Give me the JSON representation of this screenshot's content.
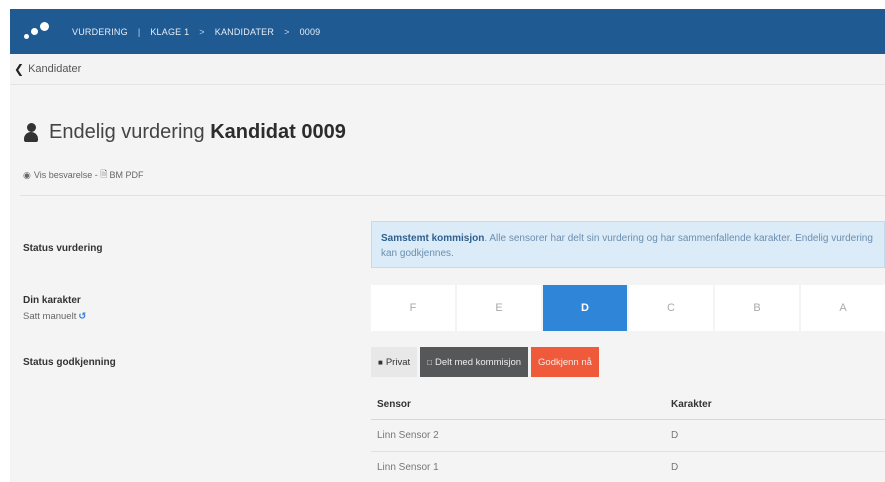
{
  "topbar": {
    "crumbs": [
      "VURDERING",
      "|",
      "KLAGE 1",
      ">",
      "KANDIDATER",
      ">",
      "0009"
    ]
  },
  "back": {
    "label": "Kandidater"
  },
  "header": {
    "title_prefix": "Endelig vurdering",
    "title_strong": "Kandidat 0009",
    "link_view": "Vis besvarelse",
    "link_sep": " - ",
    "link_pdf": "BM PDF"
  },
  "status_vurdering": {
    "label": "Status vurdering",
    "alert_strong": "Samstemt kommisjon",
    "alert_text": ". Alle sensorer har delt sin vurdering og har sammenfallende karakter. Endelig vurdering kan godkjennes."
  },
  "din_karakter": {
    "label": "Din karakter",
    "sub": "Satt manuelt",
    "grades": [
      "F",
      "E",
      "D",
      "C",
      "B",
      "A"
    ],
    "selected": "D"
  },
  "status_godkjenning": {
    "label": "Status godkjenning",
    "btn_private": "Privat",
    "btn_shared": "Delt med kommisjon",
    "btn_approve": "Godkjenn nå"
  },
  "table": {
    "headers": [
      "Sensor",
      "Karakter"
    ],
    "rows": [
      [
        "Linn Sensor 2",
        "D"
      ],
      [
        "Linn Sensor 1",
        "D"
      ]
    ]
  },
  "colors": {
    "topbar": "#1f5a93",
    "accent": "#2f86d8",
    "approve": "#ef5a3a",
    "shared": "#555759"
  }
}
